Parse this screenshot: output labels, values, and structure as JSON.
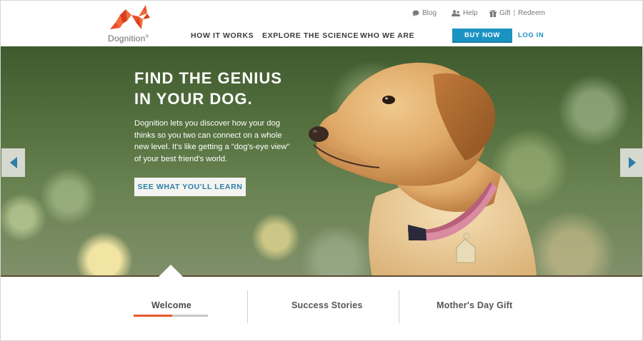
{
  "brand": {
    "name": "Dognition",
    "trademark": "®",
    "logo_colors": [
      "#e9502c",
      "#f26a34",
      "#d63e1f"
    ]
  },
  "utility_nav": {
    "blog": {
      "label": "Blog",
      "icon": "speech-bubble-icon"
    },
    "help": {
      "label": "Help",
      "icon": "people-icon"
    },
    "gift": {
      "label": "Gift",
      "separator": "|",
      "redeem": "Redeem",
      "icon": "gift-icon"
    }
  },
  "main_nav": {
    "items": [
      {
        "label": "HOW IT WORKS"
      },
      {
        "label": "EXPLORE THE SCIENCE"
      },
      {
        "label": "WHO WE ARE"
      }
    ],
    "buy_now": "BUY NOW",
    "log_in": "LOG IN",
    "accent_color": "#1b93c2"
  },
  "hero": {
    "title_line1": "FIND THE GENIUS",
    "title_line2": "IN YOUR DOG.",
    "body": "Dognition lets you discover how your dog thinks so you two can connect on a whole new level. It's like getting a \"dog's-eye view\" of your best friend's world.",
    "cta": "SEE WHAT YOU'LL LEARN",
    "prev_icon": "chevron-left-icon",
    "next_icon": "chevron-right-icon"
  },
  "tabs": {
    "items": [
      {
        "label": "Welcome",
        "active": true
      },
      {
        "label": "Success Stories",
        "active": false
      },
      {
        "label": "Mother's Day Gift",
        "active": false
      }
    ],
    "active_progress": 0.52,
    "progress_color": "#e45a2a"
  }
}
